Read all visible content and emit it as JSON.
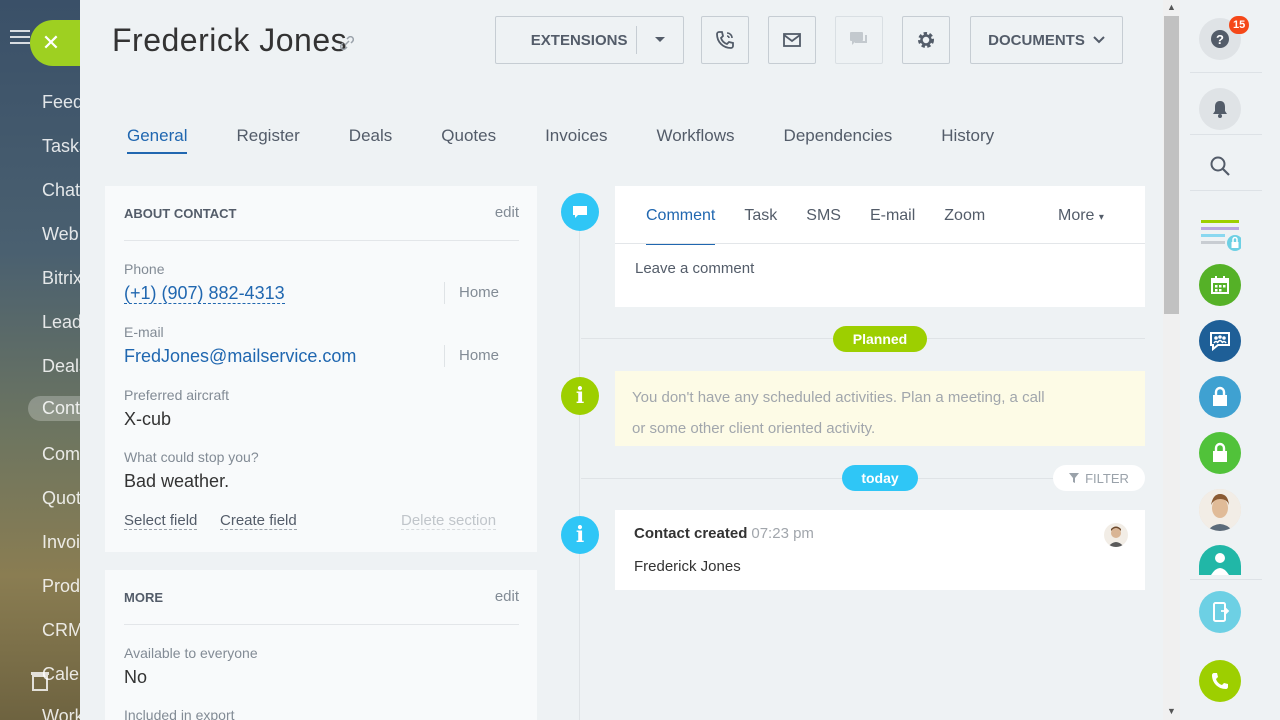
{
  "left_nav": {
    "items": [
      "Feed",
      "Tasks",
      "Chat",
      "Web",
      "Bitrix",
      "Leads",
      "Deals",
      "Contacts",
      "Companies",
      "Quotes",
      "Invoices",
      "Products",
      "CRM",
      "Calendar",
      "Workgroups"
    ]
  },
  "header": {
    "title": "Frederick  Jones",
    "extensions_label": "EXTENSIONS",
    "documents_label": "DOCUMENTS"
  },
  "tabs": [
    "General",
    "Register",
    "Deals",
    "Quotes",
    "Invoices",
    "Workflows",
    "Dependencies",
    "History"
  ],
  "about": {
    "heading": "ABOUT CONTACT",
    "edit": "edit",
    "phone_label": "Phone",
    "phone_value": "(+1) (907) 882-4313",
    "phone_type": "Home",
    "email_label": "E-mail",
    "email_value": "FredJones@mailservice.com",
    "email_type": "Home",
    "aircraft_label": "Preferred aircraft",
    "aircraft_value": "X-cub",
    "stop_label": "What could stop you?",
    "stop_value": "Bad weather.",
    "select_field": "Select field",
    "create_field": "Create field",
    "delete_section": "Delete section"
  },
  "more": {
    "heading": "MORE",
    "edit": "edit",
    "available_label": "Available to everyone",
    "available_value": "No",
    "export_label": "Included in export"
  },
  "composer": {
    "tabs": [
      "Comment",
      "Task",
      "SMS",
      "E-mail",
      "Zoom"
    ],
    "more": "More",
    "placeholder": "Leave a comment"
  },
  "timeline": {
    "planned_label": "Planned",
    "planned_text_1": "You don't have any scheduled activities. Plan a meeting, a call",
    "planned_text_2": "or some other client oriented activity.",
    "today_label": "today",
    "filter_label": "FILTER",
    "event_title": "Contact created",
    "event_time": "07:23 pm",
    "event_name": "Frederick Jones"
  },
  "right_bar": {
    "badge": "15"
  },
  "colors": {
    "accent_blue": "#2067b0",
    "green": "#9dcf00",
    "light_blue": "#2fc6f6",
    "badge_red": "#f54819"
  }
}
